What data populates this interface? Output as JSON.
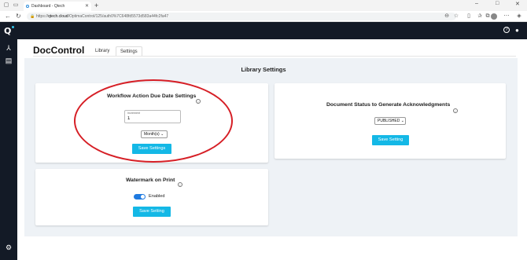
{
  "browser": {
    "tab_title": "Dashboard - Qtech",
    "new_tab": "+",
    "url_host": "qtech.cloud",
    "url_prefix": "https://",
    "url_path": "/OptimaControl/125/auth0%7C648fd5573d583a44fc2fa47",
    "window_controls": [
      "–",
      "□",
      "✕"
    ]
  },
  "app": {
    "logo_text": "Q",
    "help_label": "?"
  },
  "page": {
    "title": "DocControl",
    "tabs": [
      {
        "label": "Library",
        "active": false
      },
      {
        "label": "Settings",
        "active": true
      }
    ],
    "section_title": "Library Settings"
  },
  "workflow_card": {
    "title": "Workflow Action Due Date Settings",
    "increment_label": "Increment",
    "increment_value": "1",
    "unit_selected": "Month(s)",
    "save_label": "Save Settings"
  },
  "ack_card": {
    "title": "Document Status to Generate Acknowledgments",
    "status_selected": "PUBLISHED",
    "save_label": "Save Setting"
  },
  "watermark_card": {
    "title": "Watermark on Print",
    "toggle_label": "Enabled",
    "toggle_on": true,
    "save_label": "Save Setting"
  },
  "info_glyph": "i",
  "colors": {
    "app_header": "#131a26",
    "accent_button": "#14b8e6",
    "toggle_on": "#1f7ae0",
    "annotation_ellipse": "#d61f26",
    "panel_bg": "#eef2f6"
  }
}
